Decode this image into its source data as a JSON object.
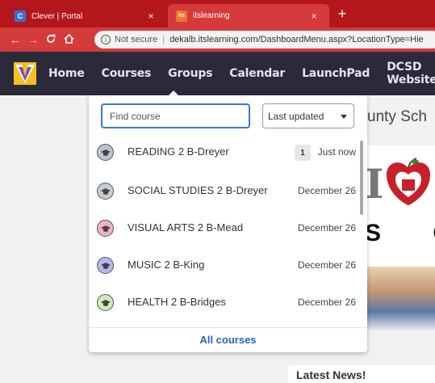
{
  "browser": {
    "tabs": [
      {
        "favicon": "C",
        "title": "Clever | Portal"
      },
      {
        "favicon": "its",
        "title": "itslearning"
      }
    ],
    "close_glyph": "×",
    "new_tab_glyph": "+",
    "nav": {
      "back": "←",
      "forward": "→",
      "reload": "C",
      "home": "⌂"
    },
    "address": {
      "info_glyph": "i",
      "security": "Not secure",
      "separator": "|",
      "url": "dekalb.itslearning.com/DashboardMenu.aspx?LocationType=Hie"
    }
  },
  "appnav": {
    "items": [
      "Home",
      "Courses",
      "Groups",
      "Calendar",
      "LaunchPad",
      "DCSD Website"
    ]
  },
  "page": {
    "school_title": "unty Sch",
    "banner_letters": "S C",
    "banner_big_letter": "I",
    "latest_news": "Latest News!"
  },
  "courses_menu": {
    "search_placeholder": "Find course",
    "sort_value": "Last updated",
    "courses": [
      {
        "name": "READING 2 B-Dreyer",
        "date": "Just now",
        "badge": "1",
        "color": "#b9c6d2"
      },
      {
        "name": "SOCIAL STUDIES 2 B-Dreyer",
        "date": "December 26",
        "color": "#c4cdd4"
      },
      {
        "name": "VISUAL ARTS 2 B-Mead",
        "date": "December 26",
        "color": "#f3b2c4"
      },
      {
        "name": "MUSIC 2 B-King",
        "date": "December 26",
        "color": "#b6b6f0"
      },
      {
        "name": "HEALTH 2 B-Bridges",
        "date": "December 26",
        "color": "#d4eab4"
      }
    ],
    "all_courses": "All courses"
  },
  "colors": {
    "tab_strip": "#b3171c",
    "toolbar": "#d43b3b",
    "appnav": "#2a2a3a",
    "accent_blue": "#3a78d4",
    "link_blue": "#2a63c4"
  }
}
